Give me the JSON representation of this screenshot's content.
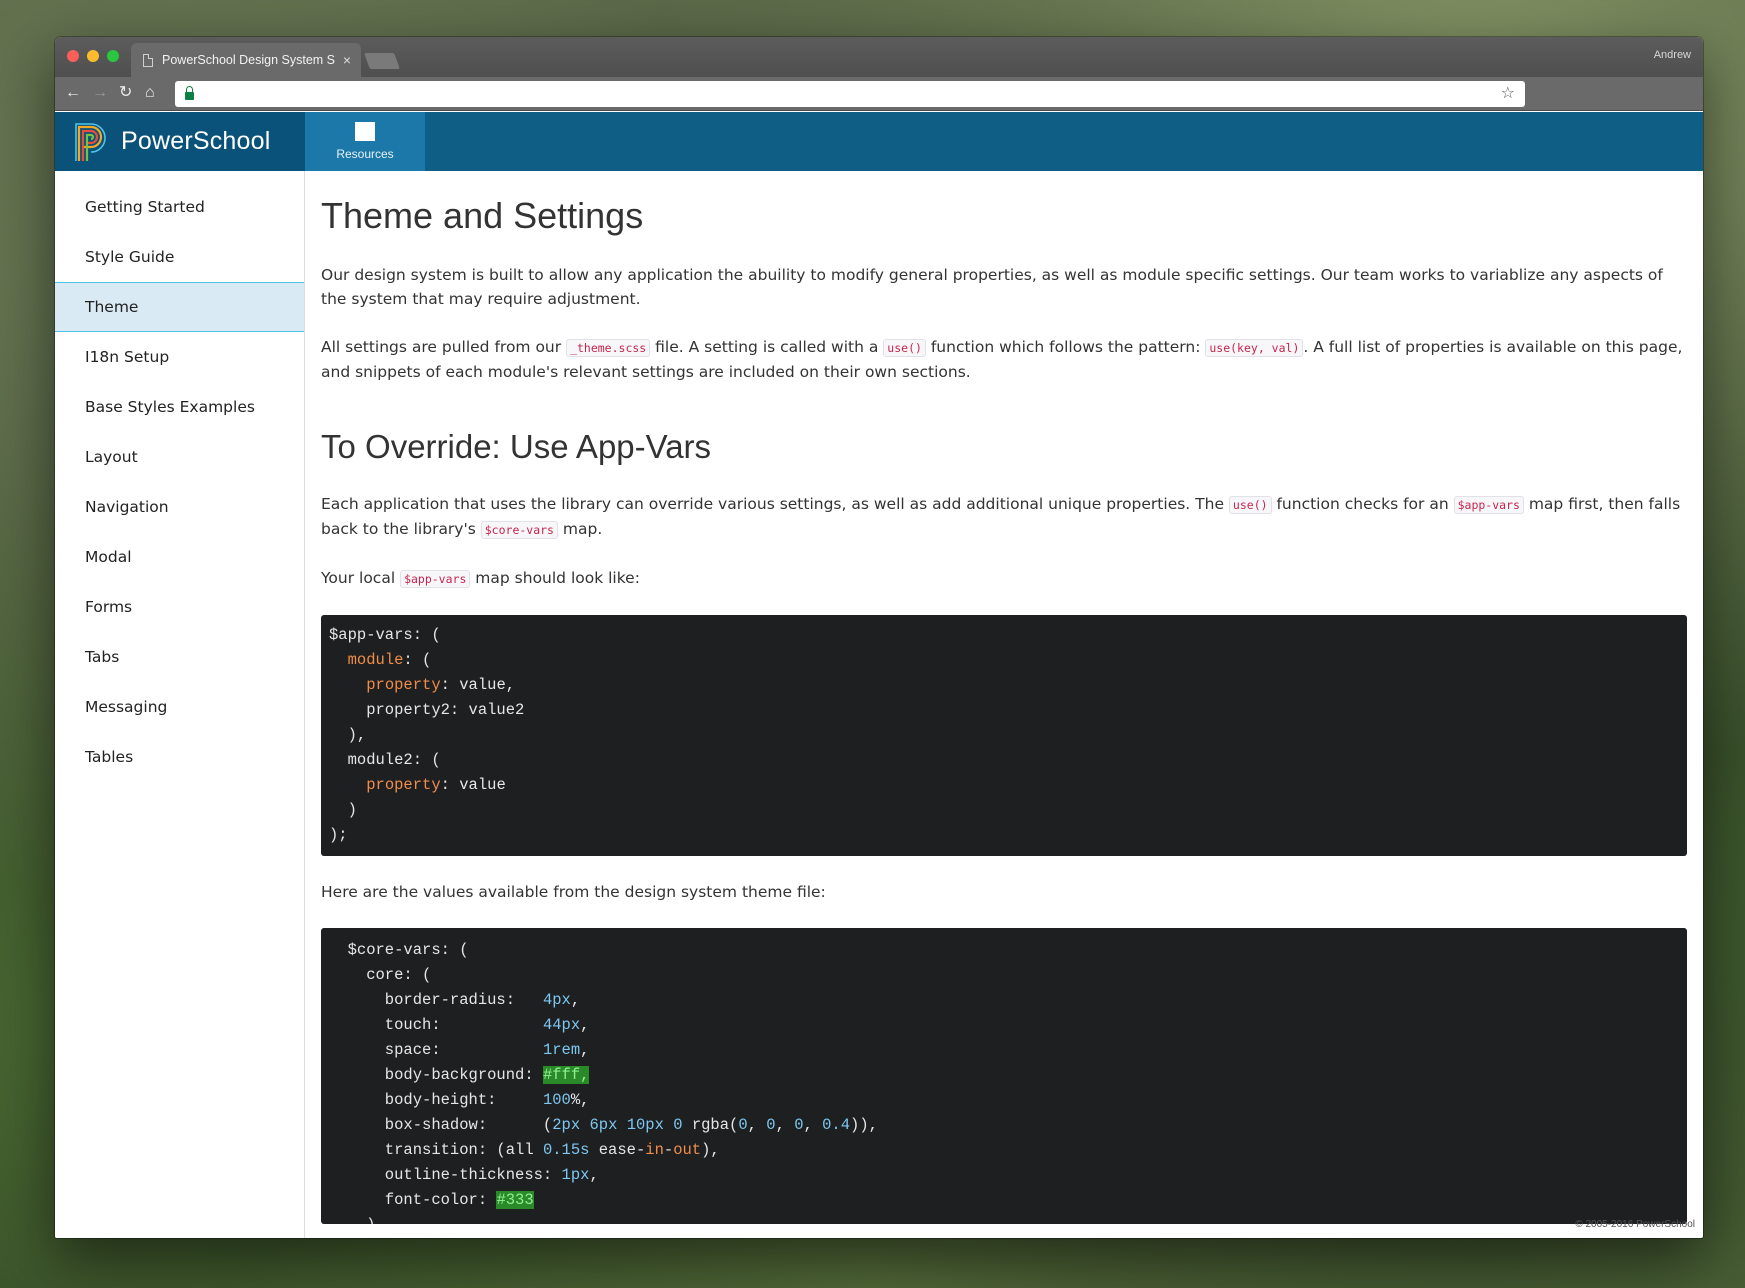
{
  "browser": {
    "tab_title": "PowerSchool Design System S",
    "tab_close": "×",
    "profile_name": "Andrew",
    "url": ""
  },
  "app": {
    "brand_name": "PowerSchool",
    "nav_resources": "Resources",
    "brand_color": "#0e5e86"
  },
  "sidebar": {
    "items": [
      {
        "label": "Getting Started"
      },
      {
        "label": "Style Guide"
      },
      {
        "label": "Theme"
      },
      {
        "label": "I18n Setup"
      },
      {
        "label": "Base Styles Examples"
      },
      {
        "label": "Layout"
      },
      {
        "label": "Navigation"
      },
      {
        "label": "Modal"
      },
      {
        "label": "Forms"
      },
      {
        "label": "Tabs"
      },
      {
        "label": "Messaging"
      },
      {
        "label": "Tables"
      }
    ],
    "active": "Theme"
  },
  "main": {
    "title": "Theme and Settings",
    "p1": "Our design system is built to allow any application the abuility to modify general properties, as well as module specific settings. Our team works to variablize any aspects of the system that may require adjustment.",
    "p2": {
      "a": "All settings are pulled from our ",
      "code1": "_theme.scss",
      "b": " file. A setting is called with a ",
      "code2": "use()",
      "c": " function which follows the pattern: ",
      "code3": "use(key, val)",
      "d": ". A full list of properties is available on this page, and snippets of each module's relevant settings are included on their own sections."
    },
    "h2": "To Override: Use App-Vars",
    "p3": {
      "a": "Each application that uses the library can override various settings, as well as add additional unique properties. The ",
      "code1": "use()",
      "b": " function checks for an ",
      "code2": "$app-vars",
      "c": " map first, then falls back to the library's ",
      "code3": "$core-vars",
      "d": " map."
    },
    "p4": {
      "a": "Your local ",
      "code1": "$app-vars",
      "b": " map should look like:"
    },
    "p5": "Here are the values available from the design system theme file:"
  },
  "footer": "© 2005-2016 PowerSchool"
}
